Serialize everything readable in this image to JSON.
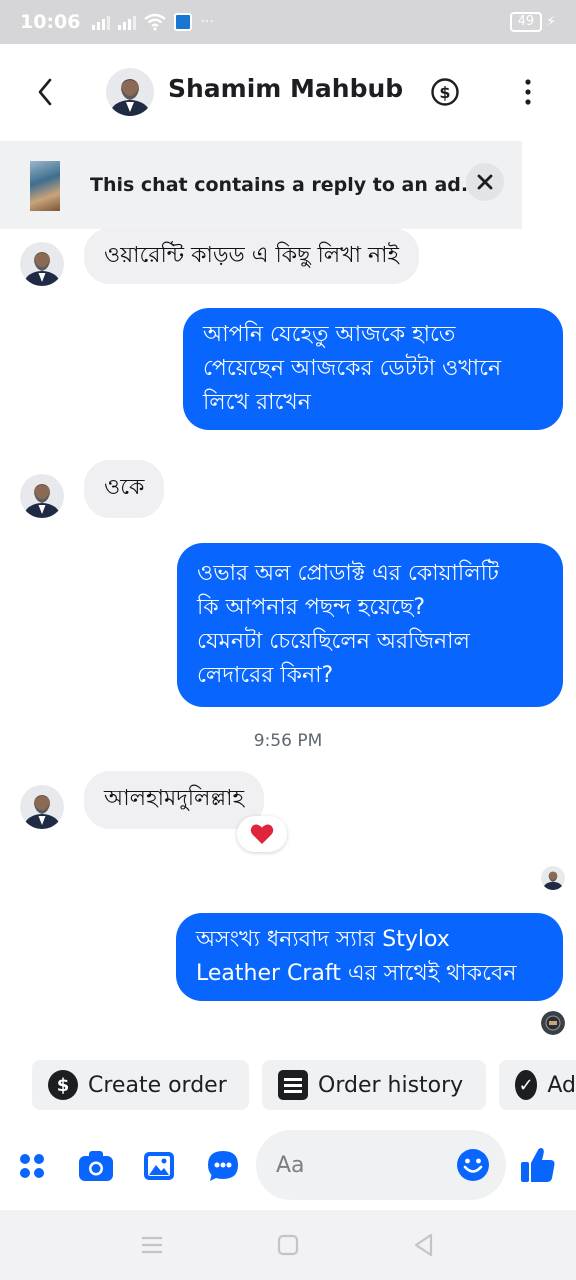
{
  "status_bar": {
    "time": "10:06",
    "battery": "49"
  },
  "header": {
    "contact_name": "Shamim Mahbub"
  },
  "ad_banner": {
    "text": "This chat contains a reply to an ad."
  },
  "messages": [
    {
      "direction": "in",
      "text": "ওয়ারেন্টি কাড়ড এ কিছু লিখা নাই"
    },
    {
      "direction": "out",
      "lines": [
        "আপনি যেহেতু আজকে হাতে",
        "পেয়েছেন আজকের ডেটটা ওখানে",
        "লিখে রাখেন"
      ]
    },
    {
      "direction": "in",
      "text": "ওকে"
    },
    {
      "direction": "out",
      "lines": [
        "ওভার অল প্রোডাক্ট এর কোয়ালিটি",
        "কি আপনার পছন্দ হয়েছে?",
        "যেমনটা চেয়েছিলেন অরজিনাল",
        "লেদারের কিনা?"
      ]
    },
    {
      "direction": "in",
      "text": "আলহামদুলিল্লাহ",
      "reaction": "❤️"
    },
    {
      "direction": "out",
      "lines": [
        "অসংখ্য ধন্যবাদ স্যার Stylox",
        "Leather Craft এর সাথেই থাকবেন"
      ]
    }
  ],
  "timestamp": "9:56 PM",
  "quick_actions": [
    {
      "label": "Create order",
      "icon": "dollar-icon"
    },
    {
      "label": "Order history",
      "icon": "list-icon"
    },
    {
      "label": "Ad",
      "icon": "check-icon"
    }
  ],
  "composer": {
    "placeholder": "Aa"
  },
  "colors": {
    "outgoing_bubble": "#0866ff",
    "incoming_bubble": "#f0f0f3",
    "accent": "#0866ff"
  }
}
